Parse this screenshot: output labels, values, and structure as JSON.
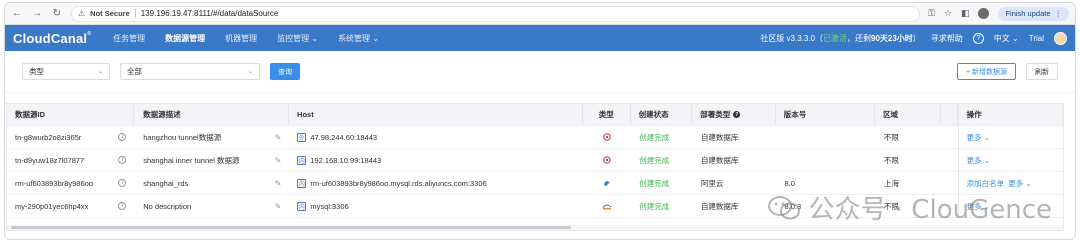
{
  "browser": {
    "security_label": "Not Secure",
    "url": "139.196.19.47:8111/#/data/dataSource",
    "finish_update_label": "Finish update"
  },
  "app": {
    "logo": "CloudCanal",
    "nav": [
      {
        "label": "任务管理",
        "active": false
      },
      {
        "label": "数据源管理",
        "active": true
      },
      {
        "label": "机器管理",
        "active": false
      },
      {
        "label": "监控管理 ⌄",
        "active": false
      },
      {
        "label": "系统管理 ⌄",
        "active": false
      }
    ],
    "edition_prefix": "社区版 v3.3.3.0（",
    "activated": "已激活",
    "edition_mid": "，还剩",
    "days_left": "90天23小时",
    "edition_suffix": "）",
    "help_label": "寻求帮助",
    "lang_label": "中文 ⌄",
    "trial_label": "Trial"
  },
  "filters": {
    "type_select": "类型",
    "scope_select": "全部",
    "query_button": "查询",
    "add_button": "+ 新增数据源",
    "refresh_button": "刷新"
  },
  "table": {
    "columns": [
      "数据源ID",
      "数据源描述",
      "Host",
      "类型",
      "创建状态",
      "部署类型",
      "版本号",
      "区域",
      "操作"
    ],
    "rows": [
      {
        "id": "tn-g8wurb2o8zi365r",
        "desc": "hangzhou tunnel数据源",
        "net": "外",
        "host": "47.98.244.60:18443",
        "type_icon": "tunnel",
        "state": "创建完成",
        "deploy": "自建数据库",
        "version": "",
        "region": "不限",
        "ops": [
          "更多 ⌄"
        ]
      },
      {
        "id": "tn-d9yuw18z7l07877",
        "desc": "shanghai inner tunnel 数据源",
        "net": "内",
        "host": "192.168.10.99:18443",
        "type_icon": "tunnel",
        "state": "创建完成",
        "deploy": "自建数据库",
        "version": "",
        "region": "不限",
        "ops": [
          "更多 ⌄"
        ]
      },
      {
        "id": "rm-uf603893br8y986oo",
        "desc": "shanghai_rds",
        "net": "内",
        "host": "rm-uf603893br8y986oo.mysql.rds.aliyuncs.com:3306",
        "type_icon": "mysql",
        "state": "创建完成",
        "deploy": "阿里云",
        "version": "8.0",
        "region": "上海",
        "ops": [
          "添加白名单",
          "更多 ⌄"
        ]
      },
      {
        "id": "my-290p01yec6hp4xx",
        "desc": "No description",
        "net": "内",
        "host": "mysql:3306",
        "type_icon": "mysql-small",
        "state": "创建完成",
        "deploy": "自建数据库",
        "version": "8.0.3",
        "region": "不限",
        "ops": [
          "更多 ⌄"
        ]
      }
    ]
  },
  "watermark": {
    "text": "公众号 · ClouGence"
  }
}
